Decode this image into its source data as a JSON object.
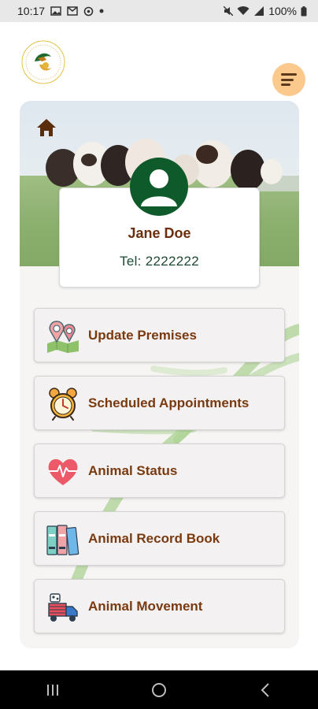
{
  "status_bar": {
    "time": "10:17",
    "battery": "100%"
  },
  "profile": {
    "name": "Jane Doe",
    "tel": "Tel: 2222222"
  },
  "menu": [
    {
      "label": "Update Premises",
      "icon": "map-pin-icon"
    },
    {
      "label": "Scheduled Appointments",
      "icon": "alarm-clock-icon"
    },
    {
      "label": "Animal Status",
      "icon": "heart-pulse-icon"
    },
    {
      "label": "Animal Record Book",
      "icon": "books-icon"
    },
    {
      "label": "Animal Movement",
      "icon": "truck-icon"
    }
  ],
  "colors": {
    "accent": "#fcc98d",
    "brand_green": "#0e5a2a",
    "label_brown": "#7a3a10",
    "name_brown": "#6b2f0d"
  }
}
